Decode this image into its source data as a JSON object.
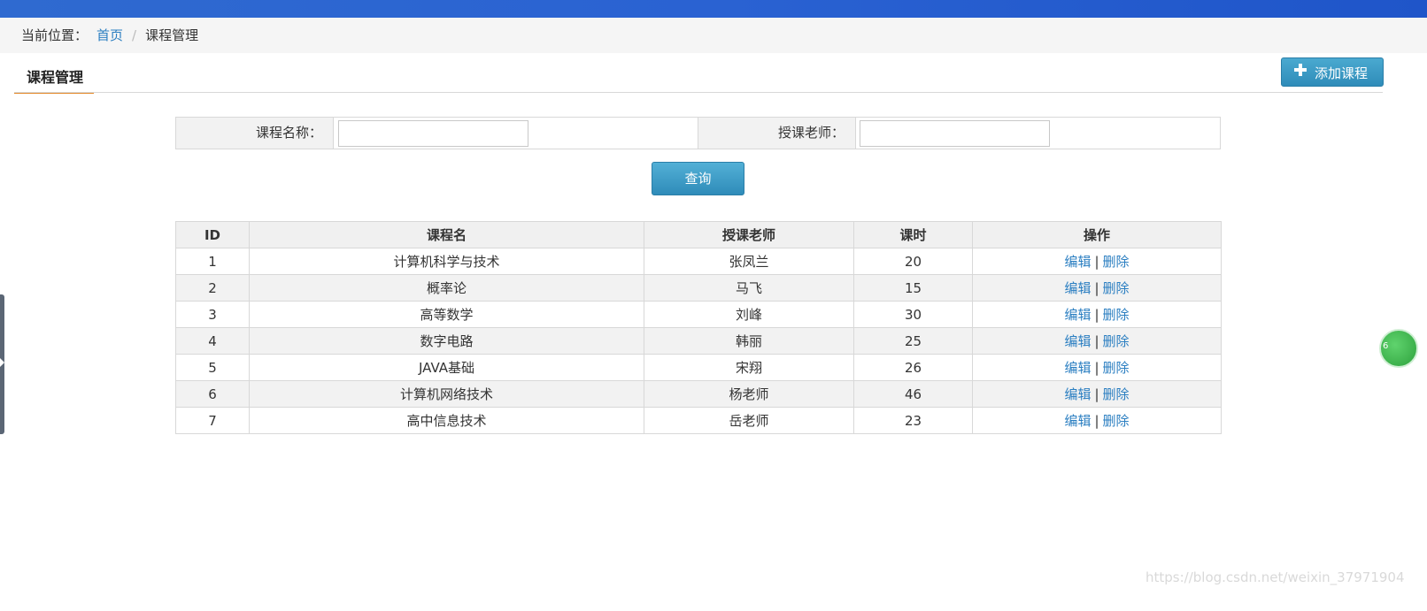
{
  "breadcrumb": {
    "prefix": "当前位置：",
    "home": "首页",
    "separator": "/",
    "current": "课程管理"
  },
  "page_tab": {
    "label": "课程管理"
  },
  "toolbar": {
    "add_label": "添加课程",
    "add_icon": "plus-icon"
  },
  "search": {
    "course_name_label": "课程名称：",
    "course_name_value": "",
    "teacher_label": "授课老师：",
    "teacher_value": "",
    "query_label": "查询"
  },
  "table": {
    "headers": [
      "ID",
      "课程名",
      "授课老师",
      "课时",
      "操作"
    ],
    "rows": [
      {
        "id": "1",
        "name": "计算机科学与技术",
        "teacher": "张凤兰",
        "hours": "20"
      },
      {
        "id": "2",
        "name": "概率论",
        "teacher": "马飞",
        "hours": "15"
      },
      {
        "id": "3",
        "name": "高等数学",
        "teacher": "刘峰",
        "hours": "30"
      },
      {
        "id": "4",
        "name": "数字电路",
        "teacher": "韩丽",
        "hours": "25"
      },
      {
        "id": "5",
        "name": "JAVA基础",
        "teacher": "宋翔",
        "hours": "26"
      },
      {
        "id": "6",
        "name": "计算机网络技术",
        "teacher": "杨老师",
        "hours": "46"
      },
      {
        "id": "7",
        "name": "高中信息技术",
        "teacher": "岳老师",
        "hours": "23"
      }
    ],
    "edit_label": "编辑",
    "op_separator": "|",
    "delete_label": "删除"
  },
  "float_ball": {
    "text": "6"
  },
  "watermark": "https://blog.csdn.net/weixin_37971904",
  "colors": {
    "top_bar": "#2a62d2",
    "accent_underline": "#e48a2a",
    "link": "#2a7ec1",
    "button": "#3a9bc6"
  }
}
